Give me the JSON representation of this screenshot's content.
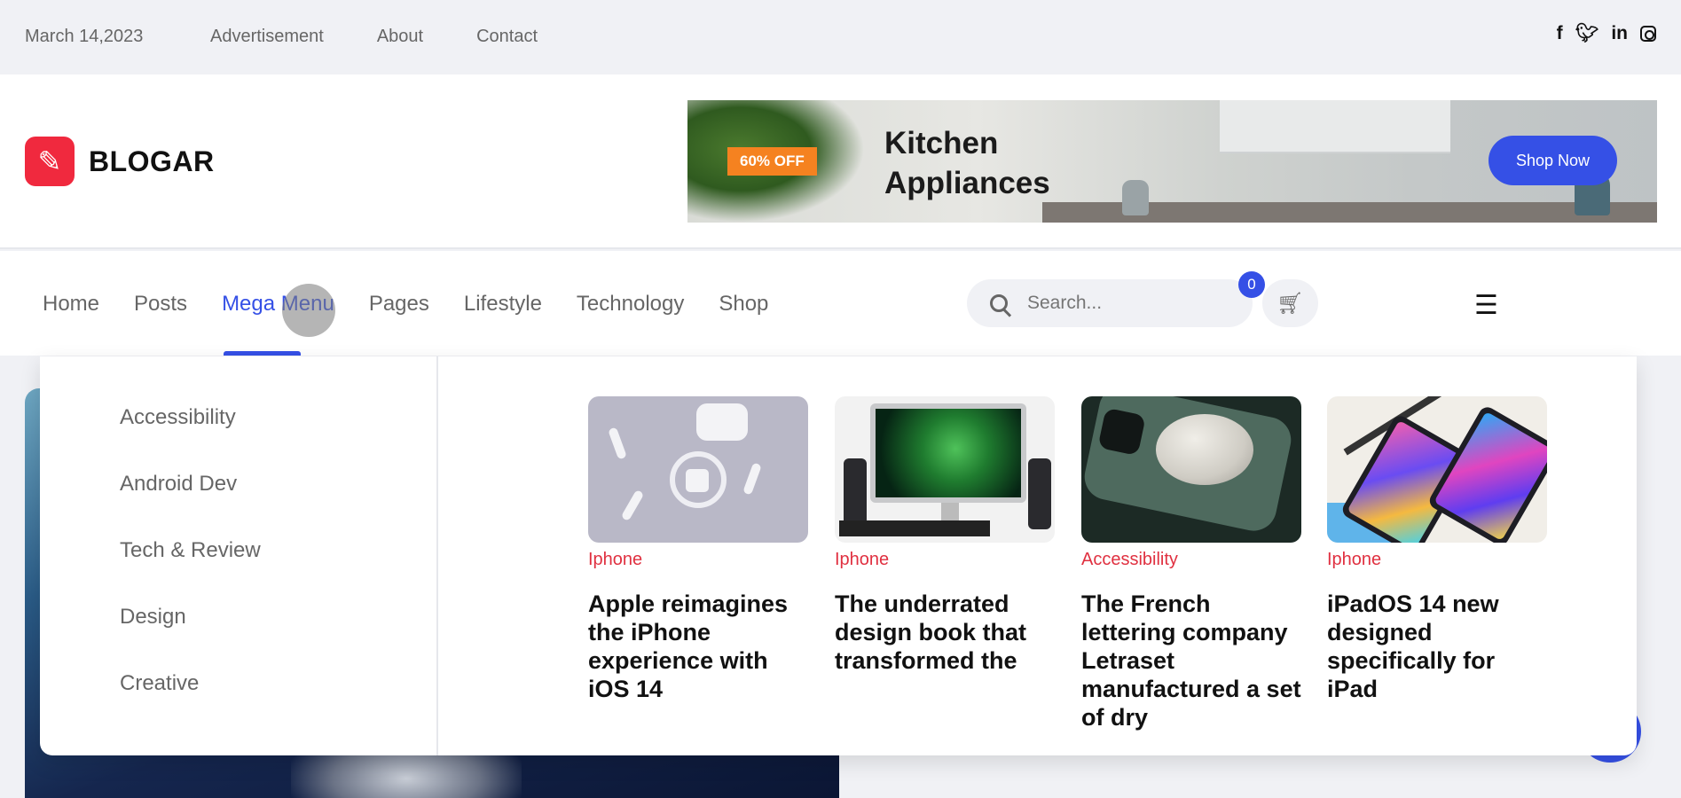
{
  "topbar": {
    "date": "March 14,2023",
    "links": [
      "Advertisement",
      "About",
      "Contact"
    ],
    "social_icons": [
      "facebook-icon",
      "twitter-icon",
      "linkedin-icon",
      "instagram-icon"
    ]
  },
  "brand": {
    "name": "BLOGAR",
    "color": "#f0293e"
  },
  "banner": {
    "tag": "60% OFF",
    "title_line1": "Kitchen",
    "title_line2": "Appliances",
    "button": "Shop Now"
  },
  "nav": {
    "items": [
      "Home",
      "Posts",
      "Mega Menu",
      "Pages",
      "Lifestyle",
      "Technology",
      "Shop"
    ],
    "active": "Mega Menu",
    "search_placeholder": "Search...",
    "cart_count": "0"
  },
  "mega_menu": {
    "categories": [
      "Accessibility",
      "Android Dev",
      "Tech & Review",
      "Design",
      "Creative"
    ],
    "posts": [
      {
        "category": "Iphone",
        "title": "Apple reimagines the iPhone experience with iOS 14"
      },
      {
        "category": "Iphone",
        "title": "The underrated design book that transformed the"
      },
      {
        "category": "Accessibility",
        "title": "The French lettering company Letraset manufactured a set of dry"
      },
      {
        "category": "Iphone",
        "title": "iPadOS 14 new designed specifically for iPad"
      }
    ]
  },
  "colors": {
    "accent": "#3550e6",
    "category": "#e03040",
    "banner_tag": "#f58220"
  }
}
